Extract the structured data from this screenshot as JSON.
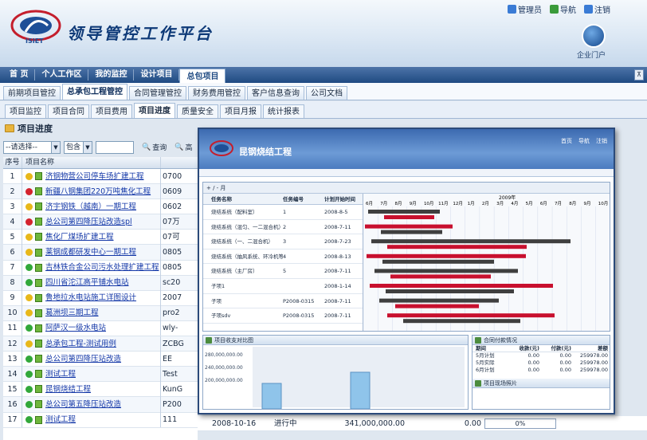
{
  "app": {
    "title": "领导管控工作平台",
    "logo_text": "ISIET"
  },
  "toplinks": [
    {
      "label": "管理员",
      "icon": "user-icon",
      "color": "#3a7bd5"
    },
    {
      "label": "导航",
      "icon": "home-icon",
      "color": "#3a9b3a"
    },
    {
      "label": "注销",
      "icon": "logout-icon",
      "color": "#3a7bd5"
    }
  ],
  "portal": {
    "label": "企业门户",
    "icon": "house-icon"
  },
  "nav1": {
    "items": [
      "首 页",
      "个人工作区",
      "我的监控",
      "设计项目",
      "总包项目"
    ],
    "active": 4,
    "collapse": "⊼"
  },
  "nav2": {
    "items": [
      "前期项目管控",
      "总承包工程管控",
      "合同管理管控",
      "财务费用管控",
      "客户信息查询",
      "公司文档"
    ],
    "active": 1
  },
  "nav3": {
    "items": [
      "项目监控",
      "项目合同",
      "项目费用",
      "项目进度",
      "质量安全",
      "项目月报",
      "统计报表"
    ],
    "active": 3
  },
  "section_title": "项目进度",
  "toolbar": {
    "select1": "--请选择--",
    "select2": "包含",
    "query_label": "查询",
    "more_label": "高"
  },
  "grid": {
    "headers": [
      "序号",
      "项目名称",
      ""
    ],
    "rows": [
      {
        "no": "1",
        "status": "yellow",
        "name": "济钢物营公司停车场扩建工程",
        "code": "0700"
      },
      {
        "no": "2",
        "status": "red",
        "name": "新疆八钢集团220万吨焦化工程",
        "code": "0609"
      },
      {
        "no": "3",
        "status": "yellow",
        "name": "济宇钢铁（越南）一期工程",
        "code": "0602"
      },
      {
        "no": "4",
        "status": "red",
        "name": "总公司第四降压站改造spl",
        "code": "07万"
      },
      {
        "no": "5",
        "status": "yellow",
        "name": "焦化厂煤场扩建工程",
        "code": "07可"
      },
      {
        "no": "6",
        "status": "yellow",
        "name": "莱钢成都研发中心一期工程",
        "code": "0805"
      },
      {
        "no": "7",
        "status": "green",
        "name": "吉林铁合金公司污水处理扩建工程",
        "code": "0805"
      },
      {
        "no": "8",
        "status": "green",
        "name": "四川省沱江高平铺水电站",
        "code": "sc20"
      },
      {
        "no": "9",
        "status": "yellow",
        "name": "鲁地拉水电站施工详图设计",
        "code": "2007"
      },
      {
        "no": "10",
        "status": "yellow",
        "name": "葛洲坝三期工程",
        "code": "pro2"
      },
      {
        "no": "11",
        "status": "green",
        "name": "阿萨汉一级水电站",
        "code": "wly-"
      },
      {
        "no": "12",
        "status": "yellow",
        "name": "总承包工程-测试用例",
        "code": "ZCBG"
      },
      {
        "no": "13",
        "status": "green",
        "name": "总公司第四降压站改造",
        "code": "EE"
      },
      {
        "no": "14",
        "status": "green",
        "name": "测试工程",
        "code": "Test"
      },
      {
        "no": "15",
        "status": "green",
        "name": "昆钢烧结工程",
        "code": "KunG"
      },
      {
        "no": "16",
        "status": "green",
        "name": "总公司第五降压站改造",
        "code": "P200"
      },
      {
        "no": "17",
        "status": "green",
        "name": "测试工程",
        "code": "111"
      }
    ]
  },
  "row17_extra": {
    "date": "2008-10-16",
    "state": "进行中",
    "amount": "341,000,000.00",
    "value": "0.00",
    "progress": "0%"
  },
  "popup": {
    "title": "昆钢烧结工程",
    "links": [
      "首页",
      "导航",
      "注销"
    ],
    "gantt_toolbar": "+ / -   月",
    "gantt_year": "2009年",
    "gantt_months": [
      "6月",
      "7月",
      "8月",
      "9月",
      "10月",
      "11月",
      "12月",
      "1月",
      "2月",
      "3月",
      "4月",
      "5月",
      "6月",
      "7月",
      "8月",
      "9月",
      "10月"
    ],
    "gantt_headers": [
      "任务名称",
      "任务编号",
      "计划开始时间"
    ],
    "gantt_rows": [
      {
        "name": "烧结系统（配料室）",
        "code": "1",
        "date": "2008-8-5"
      },
      {
        "name": "烧结系统（混匀、一二混合机）",
        "code": "2",
        "date": "2008-7-11"
      },
      {
        "name": "烧结系统（一、二混合机）",
        "code": "3",
        "date": "2008-7-23"
      },
      {
        "name": "烧结系统（抽风系统、环冷机等）",
        "code": "4",
        "date": "2008-8-13"
      },
      {
        "name": "烧结系统（主厂房）",
        "code": "5",
        "date": "2008-7-11"
      },
      {
        "name": "子项1",
        "code": "",
        "date": "2008-1-14"
      },
      {
        "name": "子项",
        "code": "P2008-0315",
        "date": "2008-7-11"
      },
      {
        "name": "子项sdv",
        "code": "P2008-0315",
        "date": "2008-7-11"
      }
    ],
    "invest_panel_title": "项目收支对比图",
    "invest_axis": [
      "280,000,000.00",
      "240,000,000.00",
      "200,000,000.00"
    ],
    "payment_panel_title": "合同付款情况",
    "payment_headers": [
      "期间",
      "收款(元)",
      "付款(元)",
      "差额"
    ],
    "payment_rows": [
      {
        "period": "5月计划",
        "in": "0.00",
        "out": "0.00",
        "diff": "259978.00"
      },
      {
        "period": "5月实际",
        "in": "0.00",
        "out": "0.00",
        "diff": "259978.00"
      },
      {
        "period": "6月计划",
        "in": "0.00",
        "out": "0.00",
        "diff": "259978.00"
      }
    ],
    "status_panel_title": "项目现场照片"
  },
  "colors": {
    "accent": "#1f4a82",
    "red": "#c8102e",
    "green": "#3aaa35",
    "yellow": "#e6b800"
  }
}
